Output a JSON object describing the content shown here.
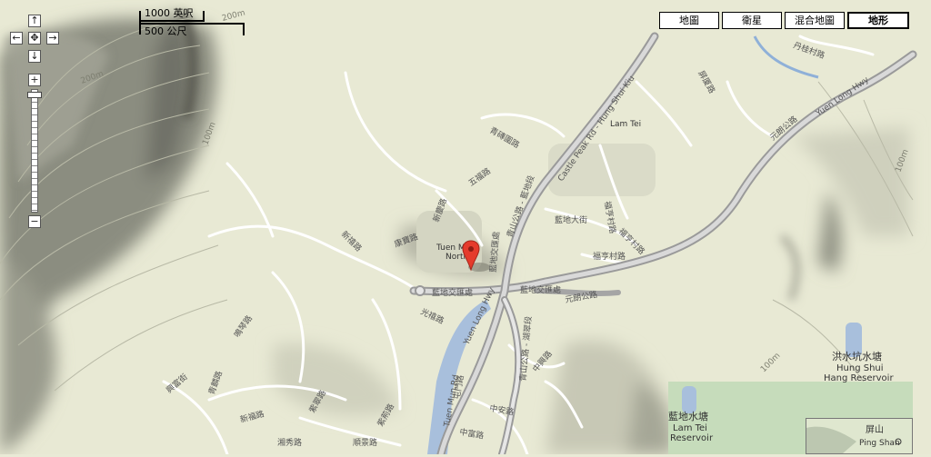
{
  "map_types": {
    "map": "地圖",
    "satellite": "衛星",
    "hybrid": "混合地圖",
    "terrain": "地形",
    "active": "terrain"
  },
  "scale": {
    "imperial": "1000 英呎",
    "metric": "500 公尺"
  },
  "nav": {
    "up": "↑",
    "left": "←",
    "center": "✥",
    "right": "→",
    "down": "↓",
    "zoom_in": "+",
    "zoom_out": "−"
  },
  "contours": {
    "c200a": "200m",
    "c200b": "200m",
    "c100a": "100m",
    "c100b": "100m",
    "c100c": "100m"
  },
  "places": {
    "lam_tei": "Lam Tei",
    "tuen_mun_north_1": "Tuen M",
    "tuen_mun_north_2": "North",
    "hung_shui_hang_zh": "洪水坑水塘",
    "hung_shui_hang_en1": "Hung Shui",
    "hung_shui_hang_en2": "Hang Reservoir",
    "lam_tei_res_zh": "藍地水塘",
    "lam_tei_res_en1": "Lam Tei",
    "lam_tei_res_en2": "Reservoir"
  },
  "roads": {
    "castle_peak": "Castle Peak Rd - Hung Shui Kiu",
    "castle_peak_zh": "青山公路 - 藍地段",
    "yuen_long_hwy": "Yuen Long Hwy",
    "yuen_long_hwy_2": "Yuen Long Hwy",
    "yuen_long_hwy_zh": "元朗公路",
    "yuen_long_hwy_zh_2": "元朗公路",
    "tuen_mun_rd": "Tuen Mun Rd",
    "lam_tei_interchange": "藍地交匯處",
    "lam_tei_interchange_2": "藍地交匯處",
    "lam_tei_interchange_3": "藍地交匯處",
    "castle_peak_tm": "青山公路 - 湖翠段",
    "road_ng_king": "五福路",
    "road_ching_yin": "青磚圍路",
    "road_lam_tei_main": "藍地大街",
    "road_fuk_hang": "福亨村路",
    "road_fuk_hang_2": "福亨村路",
    "road_fuk_hang_3": "福亨村路",
    "road_tan_kwai": "丹桂村路",
    "road_yuen_to": "屏厦路",
    "road_kong_sham": "康寶路",
    "road_san_hing": "新慶路",
    "road_hing_fuk": "興富街",
    "road_sun_fuk": "新福路",
    "road_ching_tin": "青麟路",
    "road_kwong_tin": "光禧路",
    "road_sun_yuk": "新禧路",
    "road_ming_kum": "鳴琴路",
    "road_tsz_ching": "紫翠路",
    "road_tsz_kwan": "紫荊路",
    "road_chung_on": "中安路",
    "road_chung_fu": "中富路",
    "road_chung_hing": "中興路",
    "road_heung_sze_wui": "湘秀路",
    "road_ho_king": "屯門路",
    "road_sun_king": "順景路"
  },
  "inset": {
    "zh": "屏山",
    "en": "Ping Shan"
  }
}
